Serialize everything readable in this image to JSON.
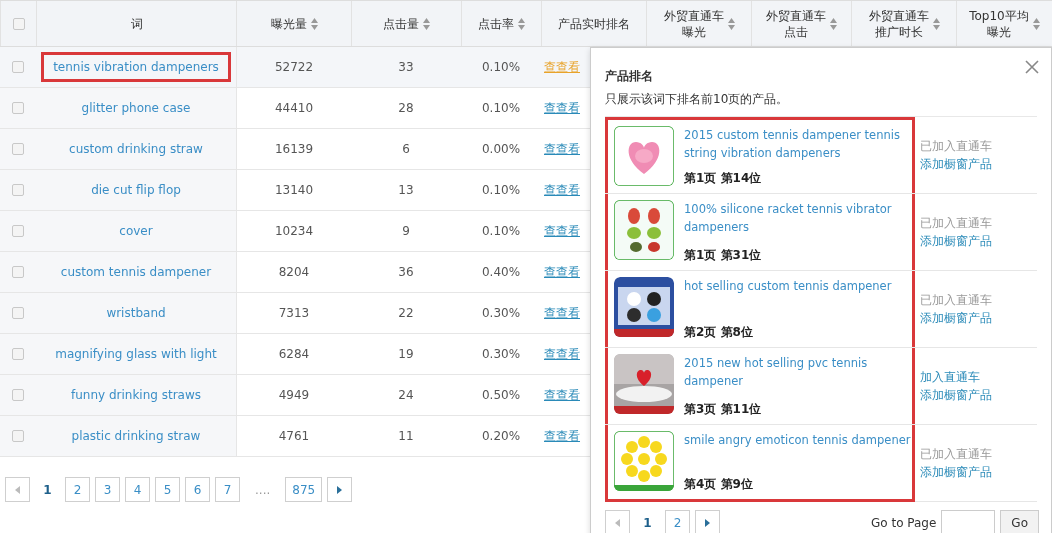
{
  "table": {
    "select_all_checked": false,
    "columns": [
      {
        "lines": [
          "词"
        ],
        "sortable": false
      },
      {
        "lines": [
          "曝光量"
        ],
        "sortable": true
      },
      {
        "lines": [
          "点击量"
        ],
        "sortable": true
      },
      {
        "lines": [
          "点击率"
        ],
        "sortable": true
      },
      {
        "lines": [
          "产品实时排名"
        ],
        "sortable": false
      },
      {
        "lines": [
          "外贸直通车",
          "曝光"
        ],
        "sortable": true
      },
      {
        "lines": [
          "外贸直通车",
          "点击"
        ],
        "sortable": true
      },
      {
        "lines": [
          "外贸直通车",
          "推广时长"
        ],
        "sortable": true
      },
      {
        "lines": [
          "Top10平均",
          "曝光"
        ],
        "sortable": true
      }
    ],
    "rows": [
      {
        "checked": false,
        "highlighted": true,
        "keyword": "tennis vibration dampeners",
        "impressions": "52722",
        "clicks": "33",
        "ctr": "0.10%",
        "rank_link": "查查看",
        "rank_link_active": true
      },
      {
        "checked": false,
        "highlighted": false,
        "keyword": "glitter phone case",
        "impressions": "44410",
        "clicks": "28",
        "ctr": "0.10%",
        "rank_link": "查查看",
        "rank_link_active": false
      },
      {
        "checked": false,
        "highlighted": false,
        "keyword": "custom drinking straw",
        "impressions": "16139",
        "clicks": "6",
        "ctr": "0.00%",
        "rank_link": "查查看",
        "rank_link_active": false
      },
      {
        "checked": false,
        "highlighted": false,
        "keyword": "die cut flip flop",
        "impressions": "13140",
        "clicks": "13",
        "ctr": "0.10%",
        "rank_link": "查查看",
        "rank_link_active": false
      },
      {
        "checked": false,
        "highlighted": false,
        "keyword": "cover",
        "impressions": "10234",
        "clicks": "9",
        "ctr": "0.10%",
        "rank_link": "查查看",
        "rank_link_active": false
      },
      {
        "checked": false,
        "highlighted": false,
        "keyword": "custom tennis dampener",
        "impressions": "8204",
        "clicks": "36",
        "ctr": "0.40%",
        "rank_link": "查查看",
        "rank_link_active": false
      },
      {
        "checked": false,
        "highlighted": false,
        "keyword": "wristband",
        "impressions": "7313",
        "clicks": "22",
        "ctr": "0.30%",
        "rank_link": "查查看",
        "rank_link_active": false
      },
      {
        "checked": false,
        "highlighted": false,
        "keyword": "magnifying glass with light",
        "impressions": "6284",
        "clicks": "19",
        "ctr": "0.30%",
        "rank_link": "查查看",
        "rank_link_active": false
      },
      {
        "checked": false,
        "highlighted": false,
        "keyword": "funny drinking straws",
        "impressions": "4949",
        "clicks": "24",
        "ctr": "0.50%",
        "rank_link": "查查看",
        "rank_link_active": false
      },
      {
        "checked": false,
        "highlighted": false,
        "keyword": "plastic drinking straw",
        "impressions": "4761",
        "clicks": "11",
        "ctr": "0.20%",
        "rank_link": "查查看",
        "rank_link_active": false
      }
    ]
  },
  "pagination": {
    "prev_disabled": true,
    "items": [
      {
        "kind": "page",
        "label": "1",
        "selected": true
      },
      {
        "kind": "page",
        "label": "2",
        "selected": false
      },
      {
        "kind": "page",
        "label": "3",
        "selected": false
      },
      {
        "kind": "page",
        "label": "4",
        "selected": false
      },
      {
        "kind": "page",
        "label": "5",
        "selected": false
      },
      {
        "kind": "page",
        "label": "6",
        "selected": false
      },
      {
        "kind": "page",
        "label": "7",
        "selected": false
      },
      {
        "kind": "ellipsis",
        "label": "....",
        "selected": false
      },
      {
        "kind": "page",
        "label": "875",
        "selected": false
      }
    ]
  },
  "popup": {
    "title": "产品排名",
    "note": "只展示该词下排名前10页的产品。",
    "products": [
      {
        "title": "2015 custom tennis dampener tennis string vibration dampeners",
        "rank": "第1页 第14位",
        "in_campaign": true,
        "status": "已加入直通车",
        "window_action": "添加橱窗产品"
      },
      {
        "title": "100% silicone racket tennis vibrator dampeners",
        "rank": "第1页 第31位",
        "in_campaign": true,
        "status": "已加入直通车",
        "window_action": "添加橱窗产品"
      },
      {
        "title": "hot selling custom tennis dampener",
        "rank": "第2页 第8位",
        "in_campaign": true,
        "status": "已加入直通车",
        "window_action": "添加橱窗产品"
      },
      {
        "title": "2015 new hot selling pvc tennis dampener",
        "rank": "第3页 第11位",
        "in_campaign": false,
        "status": "加入直通车",
        "window_action": "添加橱窗产品"
      },
      {
        "title": "smile angry emoticon tennis dampener",
        "rank": "第4页 第9位",
        "in_campaign": true,
        "status": "已加入直通车",
        "window_action": "添加橱窗产品"
      }
    ],
    "pagination": {
      "prev_disabled": true,
      "items": [
        {
          "kind": "page",
          "label": "1",
          "selected": true
        },
        {
          "kind": "page",
          "label": "2",
          "selected": false
        }
      ]
    },
    "goto_label": "Go to Page",
    "go_button": "Go"
  }
}
